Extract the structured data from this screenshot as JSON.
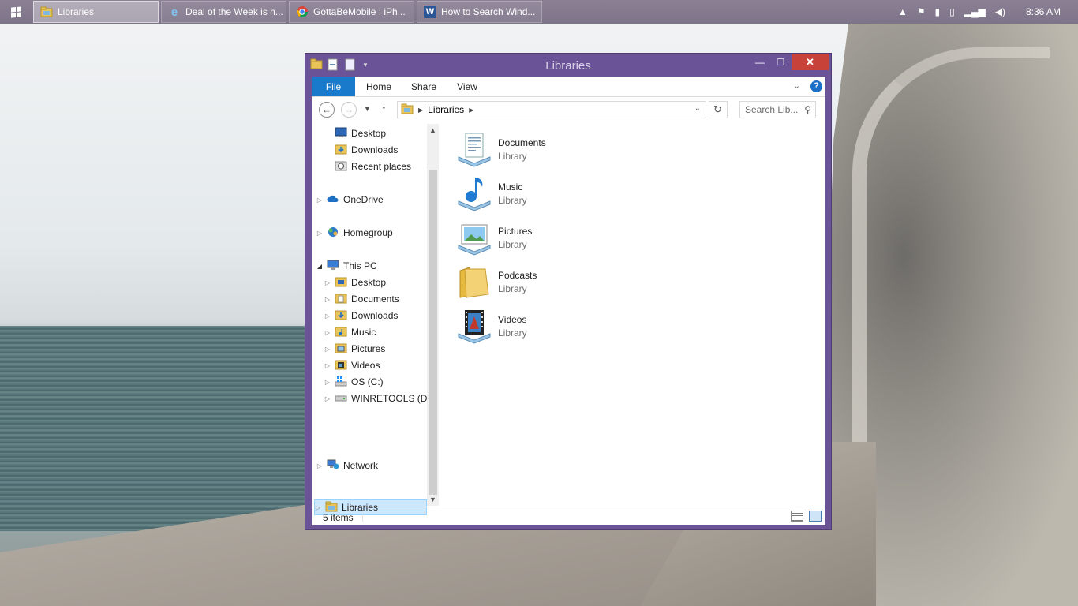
{
  "taskbar": {
    "buttons": [
      {
        "label": "Libraries",
        "icon": "folder-library-icon",
        "active": true
      },
      {
        "label": "Deal of the Week is n...",
        "icon": "internet-explorer-icon",
        "active": false
      },
      {
        "label": "GottaBeMobile : iPh...",
        "icon": "chrome-icon",
        "active": false
      },
      {
        "label": "How to Search Wind...",
        "icon": "word-icon",
        "active": false
      }
    ],
    "clock": "8:36 AM"
  },
  "window": {
    "title": "Libraries",
    "ribbon_tabs": [
      "File",
      "Home",
      "Share",
      "View"
    ],
    "address": {
      "crumb": "Libraries"
    },
    "search_placeholder": "Search Lib...",
    "navigation": [
      {
        "label": "Desktop",
        "level": 1,
        "expandable": false,
        "icon": "desktop-icon"
      },
      {
        "label": "Downloads",
        "level": 1,
        "expandable": false,
        "icon": "downloads-folder-icon"
      },
      {
        "label": "Recent places",
        "level": 1,
        "expandable": false,
        "icon": "recent-places-icon"
      },
      {
        "label": "OneDrive",
        "level": 0,
        "expandable": true,
        "icon": "onedrive-icon"
      },
      {
        "label": "Homegroup",
        "level": 0,
        "expandable": true,
        "icon": "homegroup-icon"
      },
      {
        "label": "This PC",
        "level": 0,
        "expandable": true,
        "expanded": true,
        "icon": "computer-icon"
      },
      {
        "label": "Desktop",
        "level": 1,
        "expandable": true,
        "icon": "desktop-folder-icon"
      },
      {
        "label": "Documents",
        "level": 1,
        "expandable": true,
        "icon": "documents-folder-icon"
      },
      {
        "label": "Downloads",
        "level": 1,
        "expandable": true,
        "icon": "downloads-folder-icon"
      },
      {
        "label": "Music",
        "level": 1,
        "expandable": true,
        "icon": "music-folder-icon"
      },
      {
        "label": "Pictures",
        "level": 1,
        "expandable": true,
        "icon": "pictures-folder-icon"
      },
      {
        "label": "Videos",
        "level": 1,
        "expandable": true,
        "icon": "videos-folder-icon"
      },
      {
        "label": "OS (C:)",
        "level": 1,
        "expandable": true,
        "icon": "drive-os-icon"
      },
      {
        "label": "WINRETOOLS (D:)",
        "level": 1,
        "expandable": true,
        "icon": "drive-icon"
      },
      {
        "label": "Libraries",
        "level": 0,
        "expandable": true,
        "selected": true,
        "icon": "libraries-icon"
      },
      {
        "label": "Network",
        "level": 0,
        "expandable": true,
        "icon": "network-icon"
      }
    ],
    "libraries": [
      {
        "name": "Documents",
        "type": "Library",
        "icon": "documents-library-icon"
      },
      {
        "name": "Music",
        "type": "Library",
        "icon": "music-library-icon"
      },
      {
        "name": "Pictures",
        "type": "Library",
        "icon": "pictures-library-icon"
      },
      {
        "name": "Podcasts",
        "type": "Library",
        "icon": "podcasts-library-icon"
      },
      {
        "name": "Videos",
        "type": "Library",
        "icon": "videos-library-icon"
      }
    ],
    "status": "5 items"
  },
  "colors": {
    "window_frame": "#6a5497",
    "file_tab": "#1979ca",
    "close_button": "#c7433a",
    "selection": "#cce8ff"
  }
}
